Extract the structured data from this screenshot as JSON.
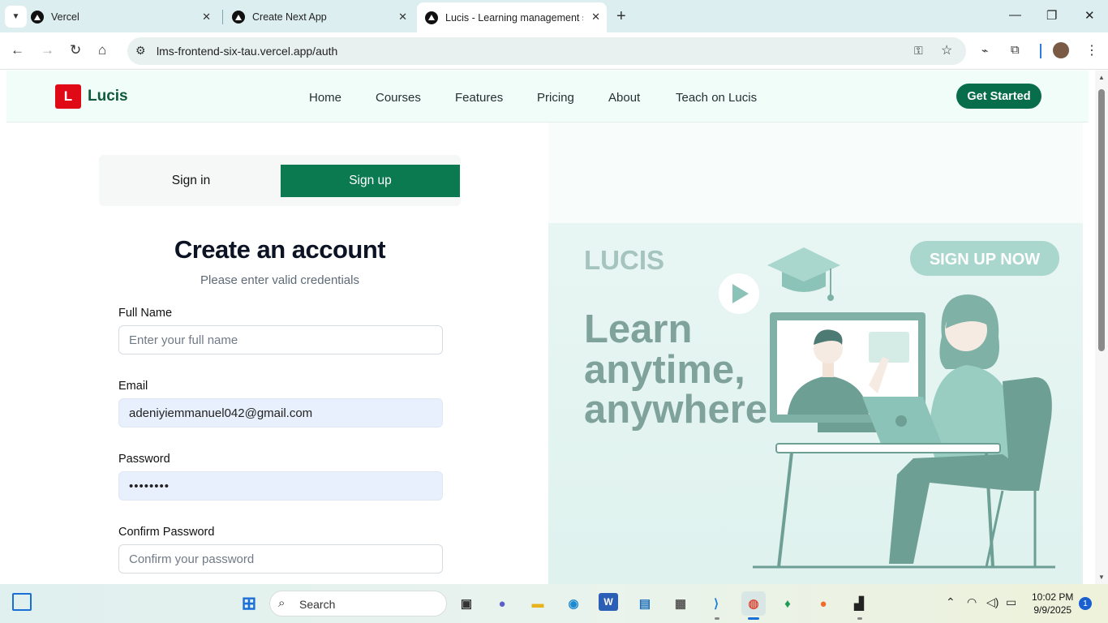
{
  "browser": {
    "tabs": [
      {
        "title": "Vercel"
      },
      {
        "title": "Create Next App"
      },
      {
        "title": "Lucis - Learning management sy"
      }
    ],
    "url": "lms-frontend-six-tau.vercel.app/auth"
  },
  "nav": {
    "logo_letter": "L",
    "logo_text": "Lucis",
    "links": [
      "Home",
      "Courses",
      "Features",
      "Pricing",
      "About",
      "Teach on Lucis"
    ],
    "cta": "Get Started"
  },
  "auth": {
    "tabs": {
      "signin": "Sign in",
      "signup": "Sign up",
      "active": "signup"
    },
    "heading": "Create an account",
    "subheading": "Please enter valid credentials",
    "fields": {
      "full_name": {
        "label": "Full Name",
        "placeholder": "Enter your full name",
        "value": ""
      },
      "email": {
        "label": "Email",
        "placeholder": "",
        "value": "adeniyiemmanuel042@gmail.com"
      },
      "password": {
        "label": "Password",
        "placeholder": "",
        "value": "••••••••"
      },
      "confirm": {
        "label": "Confirm Password",
        "placeholder": "Confirm your password",
        "value": ""
      }
    }
  },
  "hero": {
    "brand": "LUCIS",
    "button": "SIGN UP NOW",
    "headline": [
      "Learn",
      "anytime,",
      "anywhere"
    ]
  },
  "taskbar": {
    "search": "Search",
    "time": "10:02 PM",
    "date": "9/9/2025",
    "notifications": "1"
  },
  "colors": {
    "brand_green": "#0b7a51",
    "logo_red": "#e00a16",
    "hero_teal": "#7fb1a6"
  }
}
